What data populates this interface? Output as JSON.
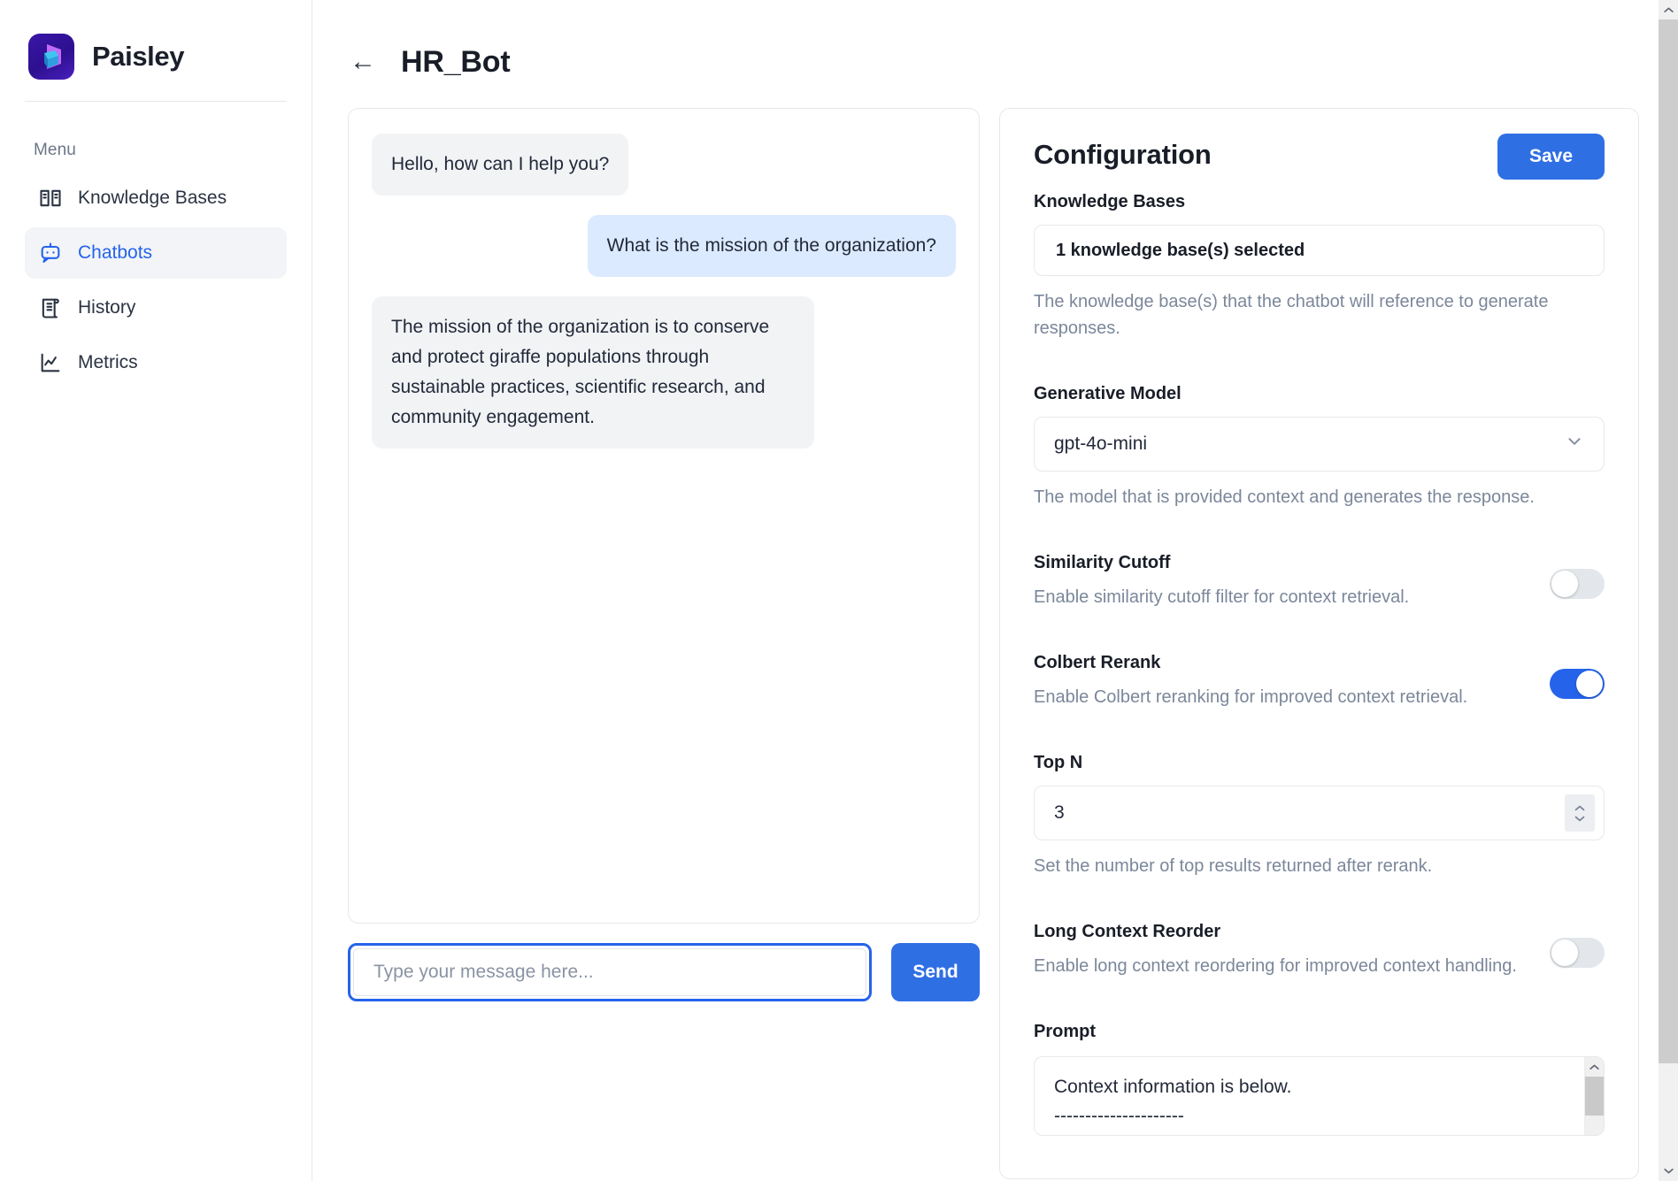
{
  "sidebar": {
    "brand_name": "Paisley",
    "menu_label": "Menu",
    "items": [
      {
        "label": "Knowledge Bases",
        "icon": "book-open-icon",
        "active": false
      },
      {
        "label": "Chatbots",
        "icon": "chatbot-icon",
        "active": true
      },
      {
        "label": "History",
        "icon": "scroll-icon",
        "active": false
      },
      {
        "label": "Metrics",
        "icon": "line-chart-icon",
        "active": false
      }
    ]
  },
  "header": {
    "back_label": "←",
    "title": "HR_Bot"
  },
  "chat": {
    "messages": [
      {
        "role": "bot",
        "text": "Hello, how can I help you?"
      },
      {
        "role": "user",
        "text": "What is the mission of the organization?"
      },
      {
        "role": "bot",
        "text": "The mission of the organization is to conserve and protect giraffe populations through sustainable practices, scientific research, and community engagement."
      }
    ],
    "input_value": "",
    "input_placeholder": "Type your message here...",
    "send_label": "Send"
  },
  "config": {
    "title": "Configuration",
    "save_label": "Save",
    "knowledge_bases": {
      "label": "Knowledge Bases",
      "value": "1 knowledge base(s) selected",
      "help": "The knowledge base(s) that the chatbot will reference to generate responses."
    },
    "generative_model": {
      "label": "Generative Model",
      "value": "gpt-4o-mini",
      "help": "The model that is provided context and generates the response."
    },
    "similarity_cutoff": {
      "label": "Similarity Cutoff",
      "desc": "Enable similarity cutoff filter for context retrieval.",
      "enabled": false
    },
    "colbert_rerank": {
      "label": "Colbert Rerank",
      "desc": "Enable Colbert reranking for improved context retrieval.",
      "enabled": true
    },
    "top_n": {
      "label": "Top N",
      "value": "3",
      "help": "Set the number of top results returned after rerank."
    },
    "long_context_reorder": {
      "label": "Long Context Reorder",
      "desc": "Enable long context reordering for improved context handling.",
      "enabled": false
    },
    "prompt": {
      "label": "Prompt",
      "value": "Context information is below.\n---------------------"
    }
  },
  "colors": {
    "accent": "#2563eb",
    "button": "#2f6fe4",
    "user_bubble": "#dbeafe",
    "bot_bubble": "#f1f3f5",
    "muted_text": "#7b879a"
  }
}
